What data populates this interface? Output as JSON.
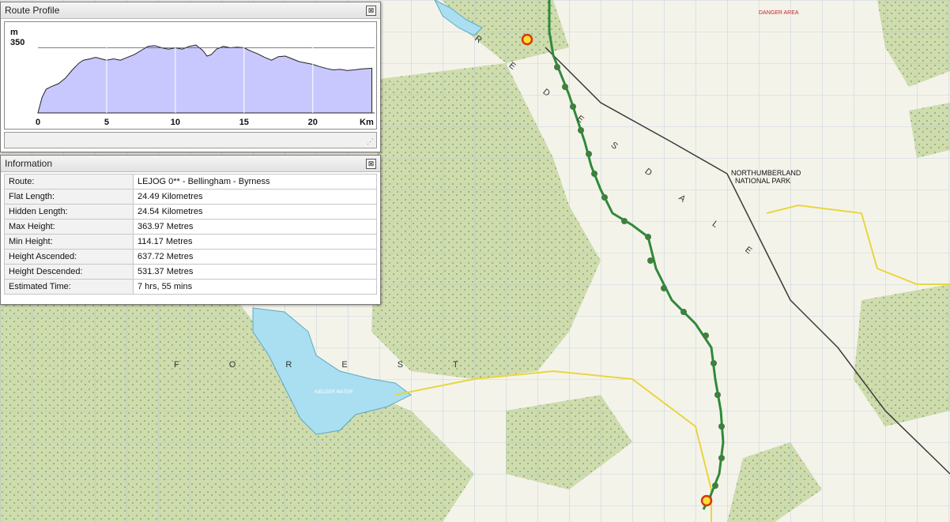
{
  "profile_panel": {
    "title": "Route Profile",
    "close": "⊠"
  },
  "info_panel": {
    "title": "Information",
    "close": "⊠"
  },
  "chart_data": {
    "type": "area",
    "xlabel": "Km",
    "ylabel": "m",
    "x_ticks": [
      "0",
      "5",
      "10",
      "15",
      "20"
    ],
    "y_ticks": [
      "350"
    ],
    "xlim": [
      0,
      24.5
    ],
    "ylim": [
      114,
      420
    ],
    "x": [
      0,
      0.3,
      0.6,
      1,
      1.5,
      2,
      2.5,
      3,
      3.3,
      3.8,
      4.2,
      4.6,
      5,
      5.5,
      6,
      6.5,
      7,
      7.5,
      8,
      8.5,
      9,
      9.5,
      10,
      10.5,
      11,
      11.5,
      12,
      12.3,
      12.6,
      13,
      13.5,
      14,
      14.5,
      15,
      15.5,
      16,
      16.5,
      17,
      17.5,
      18,
      18.5,
      19,
      19.5,
      20,
      20.5,
      21,
      21.5,
      22,
      22.5,
      23,
      23.5,
      24,
      24.3
    ],
    "y": [
      114,
      170,
      200,
      210,
      220,
      240,
      270,
      295,
      305,
      310,
      315,
      310,
      305,
      310,
      305,
      315,
      325,
      340,
      355,
      358,
      350,
      345,
      350,
      345,
      355,
      360,
      340,
      320,
      325,
      345,
      355,
      350,
      352,
      350,
      338,
      328,
      315,
      305,
      318,
      320,
      310,
      300,
      295,
      290,
      282,
      275,
      270,
      272,
      268,
      270,
      273,
      275,
      276
    ]
  },
  "info_rows": [
    {
      "key": "Route:",
      "value": "LEJOG 0** - Bellingham - Byrness"
    },
    {
      "key": "Flat Length:",
      "value": "24.49 Kilometres"
    },
    {
      "key": "Hidden Length:",
      "value": "24.54 Kilometres"
    },
    {
      "key": "Max Height:",
      "value": "363.97 Metres"
    },
    {
      "key": "Min Height:",
      "value": "114.17 Metres"
    },
    {
      "key": "Height Ascended:",
      "value": "637.72 Metres"
    },
    {
      "key": "Height Descended:",
      "value": "531.37 Metres"
    },
    {
      "key": "Estimated Time:",
      "value": "7 hrs, 55 mins"
    }
  ],
  "map": {
    "park_label_1": "NORTHUMBERLAND",
    "park_label_2": "NATIONAL PARK",
    "reservoir_label": "KIELDER WATER",
    "danger_label": "DANGER AREA",
    "forest_letters": "F O R E S T",
    "redesdale_letters": "R E D E S D A L E",
    "route_color": "#2f8a3a",
    "forest_color": "#cfdcae",
    "moor_color": "#f4f3ea",
    "water_color": "#a9dff0"
  }
}
